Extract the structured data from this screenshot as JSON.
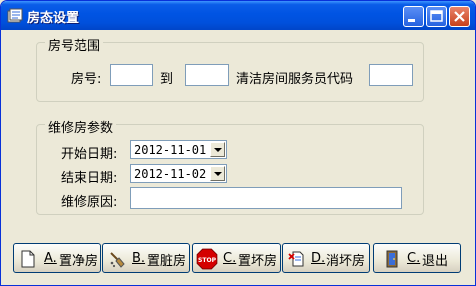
{
  "window": {
    "title": "房态设置"
  },
  "room_range": {
    "group_title": "房号范围",
    "room_label": "房号:",
    "from_value": "",
    "to_label": "到",
    "to_value": "",
    "cleaner_label": "清洁房间服务员代码",
    "cleaner_value": ""
  },
  "maintenance": {
    "group_title": "维修房参数",
    "start_label": "开始日期:",
    "start_value": "2012-11-01",
    "end_label": "结束日期:",
    "end_value": "2012-11-02",
    "reason_label": "维修原因:",
    "reason_value": ""
  },
  "buttons": [
    {
      "key": "A.",
      "label": "置净房",
      "icon": "blank-page-icon"
    },
    {
      "key": "B.",
      "label": "置脏房",
      "icon": "broom-icon"
    },
    {
      "key": "C.",
      "label": "置坏房",
      "icon": "stop-sign-icon",
      "icon_text": "STOP"
    },
    {
      "key": "D.",
      "label": "消坏房",
      "icon": "page-cancel-icon"
    },
    {
      "key": "C.",
      "label": "退出",
      "icon": "exit-door-icon"
    }
  ],
  "colors": {
    "titlebar": "#0054e3",
    "window_bg": "#ece9d8",
    "stop_red": "#d40000"
  }
}
